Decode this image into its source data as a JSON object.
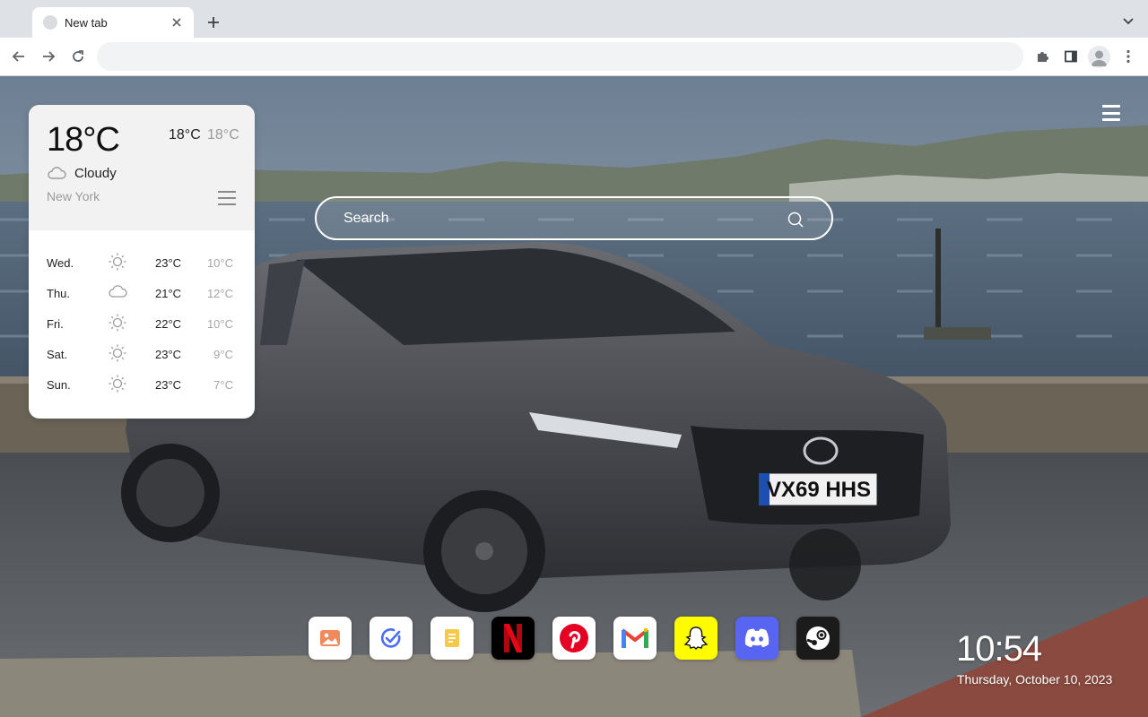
{
  "browser": {
    "tab_title": "New tab",
    "omnibox_value": "",
    "omnibox_placeholder": ""
  },
  "search": {
    "placeholder": "Search"
  },
  "weather": {
    "current_temp": "18°C",
    "high": "18°C",
    "low": "18°C",
    "condition": "Cloudy",
    "condition_icon": "cloud-icon",
    "city": "New York",
    "forecast": [
      {
        "day": "Wed.",
        "icon": "sun-icon",
        "high": "23°C",
        "low": "10°C"
      },
      {
        "day": "Thu.",
        "icon": "cloud-icon",
        "high": "21°C",
        "low": "12°C"
      },
      {
        "day": "Fri.",
        "icon": "sun-icon",
        "high": "22°C",
        "low": "10°C"
      },
      {
        "day": "Sat.",
        "icon": "sun-icon",
        "high": "23°C",
        "low": "9°C"
      },
      {
        "day": "Sun.",
        "icon": "sun-icon",
        "high": "23°C",
        "low": "7°C"
      }
    ]
  },
  "dock": {
    "apps": [
      {
        "icon": "wallpaper-gallery-icon",
        "bg": "#ffffff"
      },
      {
        "icon": "todo-check-icon",
        "bg": "#ffffff"
      },
      {
        "icon": "notes-icon",
        "bg": "#ffffff"
      },
      {
        "icon": "netflix-icon",
        "bg": "#000000"
      },
      {
        "icon": "pinterest-icon",
        "bg": "#ffffff"
      },
      {
        "icon": "gmail-icon",
        "bg": "#ffffff"
      },
      {
        "icon": "snapchat-icon",
        "bg": "#fffc00"
      },
      {
        "icon": "discord-icon",
        "bg": "#5865f2"
      },
      {
        "icon": "steam-icon",
        "bg": "#1b1b1b"
      }
    ]
  },
  "clock": {
    "time": "10:54",
    "date": "Thursday, October 10, 2023"
  },
  "wallpaper": {
    "license_plate": "VX69 HHS"
  }
}
